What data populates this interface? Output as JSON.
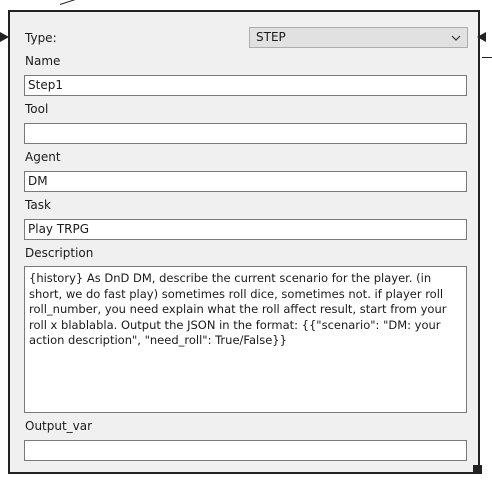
{
  "type": {
    "label": "Type:",
    "value": "STEP"
  },
  "fields": {
    "name": {
      "label": "Name",
      "value": "Step1"
    },
    "tool": {
      "label": "Tool",
      "value": ""
    },
    "agent": {
      "label": "Agent",
      "value": "DM"
    },
    "task": {
      "label": "Task",
      "value": "Play TRPG"
    },
    "description": {
      "label": "Description",
      "value": "{history} As DnD DM, describe the current scenario for the player. (in short, we do fast play) sometimes roll dice, sometimes not. if player roll roll_number, you need explain what the roll affect result, start from your roll x blablabla. Output the JSON in the format: {{\"scenario\": \"DM: your action description\", \"need_roll\": True/False}}"
    },
    "output_var": {
      "label": "Output_var",
      "value": ""
    }
  },
  "icons": {
    "dropdown": "chevron-down-icon",
    "input_port": "arrow-right-icon",
    "output_port": "arrow-left-icon",
    "resize": "resize-grip-icon"
  },
  "colors": {
    "panel_bg": "#f0f0f0",
    "border": "#222222",
    "field_border": "#7a7a7a",
    "select_bg": "#e1e1e1"
  }
}
